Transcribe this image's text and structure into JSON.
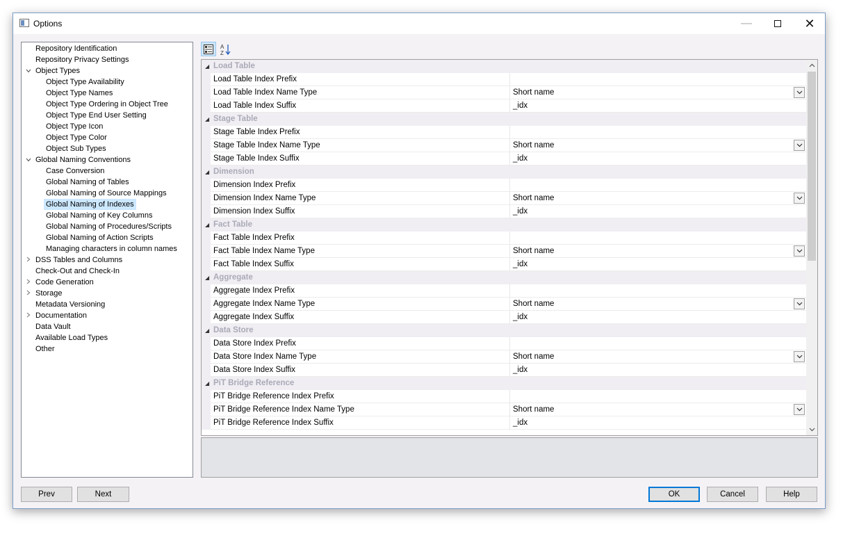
{
  "window": {
    "title": "Options"
  },
  "tree": [
    {
      "label": "Repository Identification",
      "level": 0,
      "expander": ""
    },
    {
      "label": "Repository Privacy Settings",
      "level": 0,
      "expander": ""
    },
    {
      "label": "Object Types",
      "level": 0,
      "expander": "expanded"
    },
    {
      "label": "Object Type Availability",
      "level": 1,
      "expander": ""
    },
    {
      "label": "Object Type Names",
      "level": 1,
      "expander": ""
    },
    {
      "label": "Object Type Ordering in Object Tree",
      "level": 1,
      "expander": ""
    },
    {
      "label": "Object Type End User Setting",
      "level": 1,
      "expander": ""
    },
    {
      "label": "Object Type Icon",
      "level": 1,
      "expander": ""
    },
    {
      "label": "Object Type Color",
      "level": 1,
      "expander": ""
    },
    {
      "label": "Object Sub Types",
      "level": 1,
      "expander": ""
    },
    {
      "label": "Global Naming Conventions",
      "level": 0,
      "expander": "expanded"
    },
    {
      "label": "Case Conversion",
      "level": 1,
      "expander": ""
    },
    {
      "label": "Global Naming of Tables",
      "level": 1,
      "expander": ""
    },
    {
      "label": "Global Naming of Source Mappings",
      "level": 1,
      "expander": ""
    },
    {
      "label": "Global Naming of Indexes",
      "level": 1,
      "expander": "",
      "selected": true
    },
    {
      "label": "Global Naming of Key Columns",
      "level": 1,
      "expander": ""
    },
    {
      "label": "Global Naming of Procedures/Scripts",
      "level": 1,
      "expander": ""
    },
    {
      "label": "Global Naming of Action Scripts",
      "level": 1,
      "expander": ""
    },
    {
      "label": "Managing characters in column names",
      "level": 1,
      "expander": ""
    },
    {
      "label": "DSS Tables and Columns",
      "level": 0,
      "expander": "collapsed"
    },
    {
      "label": "Check-Out and Check-In",
      "level": 0,
      "expander": ""
    },
    {
      "label": "Code Generation",
      "level": 0,
      "expander": "collapsed"
    },
    {
      "label": "Storage",
      "level": 0,
      "expander": "collapsed"
    },
    {
      "label": "Metadata Versioning",
      "level": 0,
      "expander": ""
    },
    {
      "label": "Documentation",
      "level": 0,
      "expander": "collapsed"
    },
    {
      "label": "Data Vault",
      "level": 0,
      "expander": ""
    },
    {
      "label": "Available Load Types",
      "level": 0,
      "expander": ""
    },
    {
      "label": "Other",
      "level": 0,
      "expander": ""
    }
  ],
  "toolbar": {
    "categorized_icon": "categorized-view-icon",
    "alphabetical_icon": "alphabetical-sort-icon"
  },
  "grid": {
    "categories": [
      {
        "name": "Load Table",
        "props": [
          {
            "name": "Load Table Index Prefix",
            "value": "",
            "dropdown": false
          },
          {
            "name": "Load Table Index Name Type",
            "value": "Short name",
            "dropdown": true
          },
          {
            "name": "Load Table Index Suffix",
            "value": "_idx",
            "dropdown": false
          }
        ]
      },
      {
        "name": "Stage Table",
        "props": [
          {
            "name": "Stage Table Index Prefix",
            "value": "",
            "dropdown": false
          },
          {
            "name": "Stage Table Index Name Type",
            "value": "Short name",
            "dropdown": true
          },
          {
            "name": "Stage Table Index Suffix",
            "value": "_idx",
            "dropdown": false
          }
        ]
      },
      {
        "name": "Dimension",
        "props": [
          {
            "name": "Dimension Index Prefix",
            "value": "",
            "dropdown": false
          },
          {
            "name": "Dimension Index Name Type",
            "value": "Short name",
            "dropdown": true
          },
          {
            "name": "Dimension Index Suffix",
            "value": "_idx",
            "dropdown": false
          }
        ]
      },
      {
        "name": "Fact Table",
        "props": [
          {
            "name": "Fact Table Index Prefix",
            "value": "",
            "dropdown": false
          },
          {
            "name": "Fact Table Index Name Type",
            "value": "Short name",
            "dropdown": true
          },
          {
            "name": "Fact Table Index Suffix",
            "value": "_idx",
            "dropdown": false
          }
        ]
      },
      {
        "name": "Aggregate",
        "props": [
          {
            "name": "Aggregate Index Prefix",
            "value": "",
            "dropdown": false
          },
          {
            "name": "Aggregate Index Name Type",
            "value": "Short name",
            "dropdown": true
          },
          {
            "name": "Aggregate Index Suffix",
            "value": "_idx",
            "dropdown": false
          }
        ]
      },
      {
        "name": "Data Store",
        "props": [
          {
            "name": "Data Store Index Prefix",
            "value": "",
            "dropdown": false
          },
          {
            "name": "Data Store Index Name Type",
            "value": "Short name",
            "dropdown": true
          },
          {
            "name": "Data Store Index Suffix",
            "value": "_idx",
            "dropdown": false
          }
        ]
      },
      {
        "name": "PiT Bridge Reference",
        "props": [
          {
            "name": "PiT Bridge Reference Index Prefix",
            "value": "",
            "dropdown": false
          },
          {
            "name": "PiT Bridge Reference Index Name Type",
            "value": "Short name",
            "dropdown": true
          },
          {
            "name": "PiT Bridge Reference Index Suffix",
            "value": "_idx",
            "dropdown": false
          }
        ]
      }
    ]
  },
  "buttons": {
    "prev": "Prev",
    "next": "Next",
    "ok": "OK",
    "cancel": "Cancel",
    "help": "Help"
  },
  "colors": {
    "accent": "#0078d7",
    "selection": "#cce8ff",
    "category_text": "#aaaab8"
  }
}
